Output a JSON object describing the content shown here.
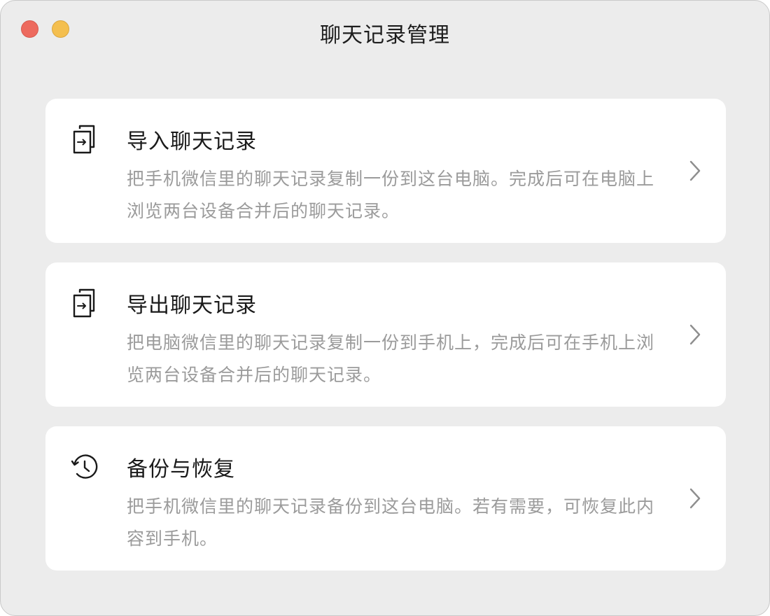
{
  "window": {
    "title": "聊天记录管理"
  },
  "cards": [
    {
      "title": "导入聊天记录",
      "description": "把手机微信里的聊天记录复制一份到这台电脑。完成后可在电脑上浏览两台设备合并后的聊天记录。",
      "icon": "import-icon"
    },
    {
      "title": "导出聊天记录",
      "description": "把电脑微信里的聊天记录复制一份到手机上，完成后可在手机上浏览两台设备合并后的聊天记录。",
      "icon": "export-icon"
    },
    {
      "title": "备份与恢复",
      "description": "把手机微信里的聊天记录备份到这台电脑。若有需要，可恢复此内容到手机。",
      "icon": "history-clock-icon"
    }
  ],
  "colors": {
    "window_bg": "#ececec",
    "card_bg": "#ffffff",
    "title_text": "#1a1a1a",
    "desc_text": "#9b9b9b",
    "close_button": "#ed6a5e",
    "minimize_button": "#f4bf4f"
  }
}
